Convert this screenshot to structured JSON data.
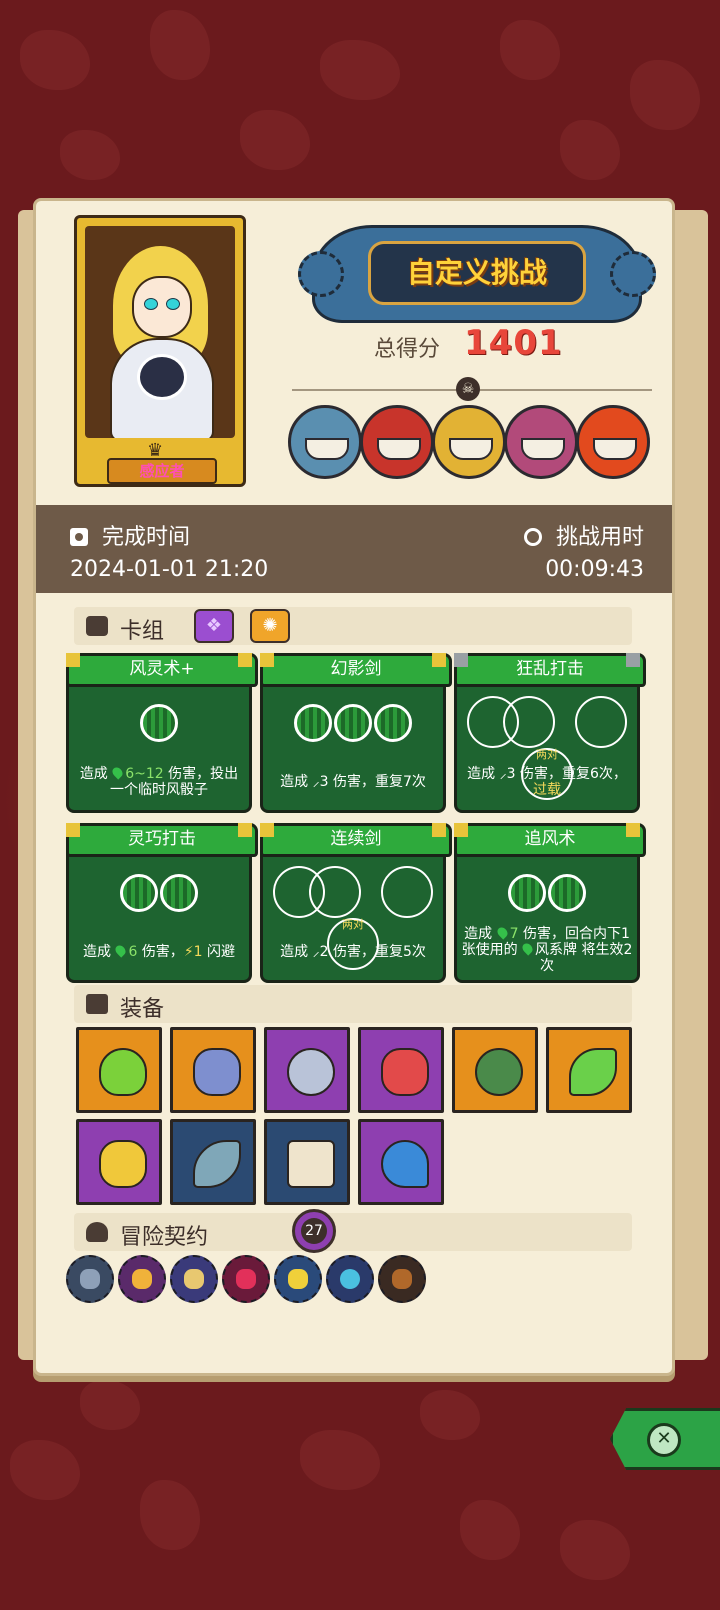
{
  "hero": {
    "name": "感应者"
  },
  "challenge": {
    "title": "自定义挑战",
    "score_label": "总得分",
    "score": "1401"
  },
  "bosses": [
    "boss-1",
    "boss-2",
    "boss-3",
    "boss-4",
    "boss-5"
  ],
  "times": {
    "completion_label": "完成时间",
    "completion_value": "2024-01-01 21:20",
    "duration_label": "挑战用时",
    "duration_value": "00:09:43"
  },
  "deck": {
    "title": "卡组",
    "cards": [
      {
        "name": "风灵术+",
        "desc_pre": "造成",
        "desc_hl": "6~12",
        "desc_post": "伤害，投出一个临时风骰子"
      },
      {
        "name": "幻影剑",
        "desc": "造成 ⸝3 伤害，重复7次"
      },
      {
        "name": "狂乱打击",
        "pair": "两对",
        "desc": "造成 ⸝3 伤害，重复6次，",
        "desc_extra": "过载"
      },
      {
        "name": "灵巧打击",
        "desc_pre": "造成",
        "desc_hl": "6",
        "desc_mid": "伤害，",
        "desc_bolt": "⚡1",
        "desc_post": "闪避"
      },
      {
        "name": "连续剑",
        "pair": "两对",
        "desc": "造成 ⸝2 伤害，重复5次"
      },
      {
        "name": "追风术",
        "desc_pre": "造成",
        "desc_hl": "7",
        "desc_post": "伤害，回合内下1张使用的",
        "desc_hl2": "风系牌",
        "desc_end": "将生效2次"
      }
    ]
  },
  "equipment": {
    "title": "装备",
    "items": [
      {
        "name": "green-potion",
        "color": "orange"
      },
      {
        "name": "battle-axe",
        "color": "orange"
      },
      {
        "name": "diamond-ring",
        "color": "purple"
      },
      {
        "name": "red-cloak",
        "color": "purple"
      },
      {
        "name": "turtle-shell",
        "color": "orange"
      },
      {
        "name": "green-feather",
        "color": "orange"
      },
      {
        "name": "golden-box",
        "color": "purple"
      },
      {
        "name": "scythe-blade",
        "color": "blue"
      },
      {
        "name": "scroll",
        "color": "blue"
      },
      {
        "name": "crescent-blade",
        "color": "purple"
      }
    ]
  },
  "pacts": {
    "title": "冒险契约",
    "count": "27"
  }
}
